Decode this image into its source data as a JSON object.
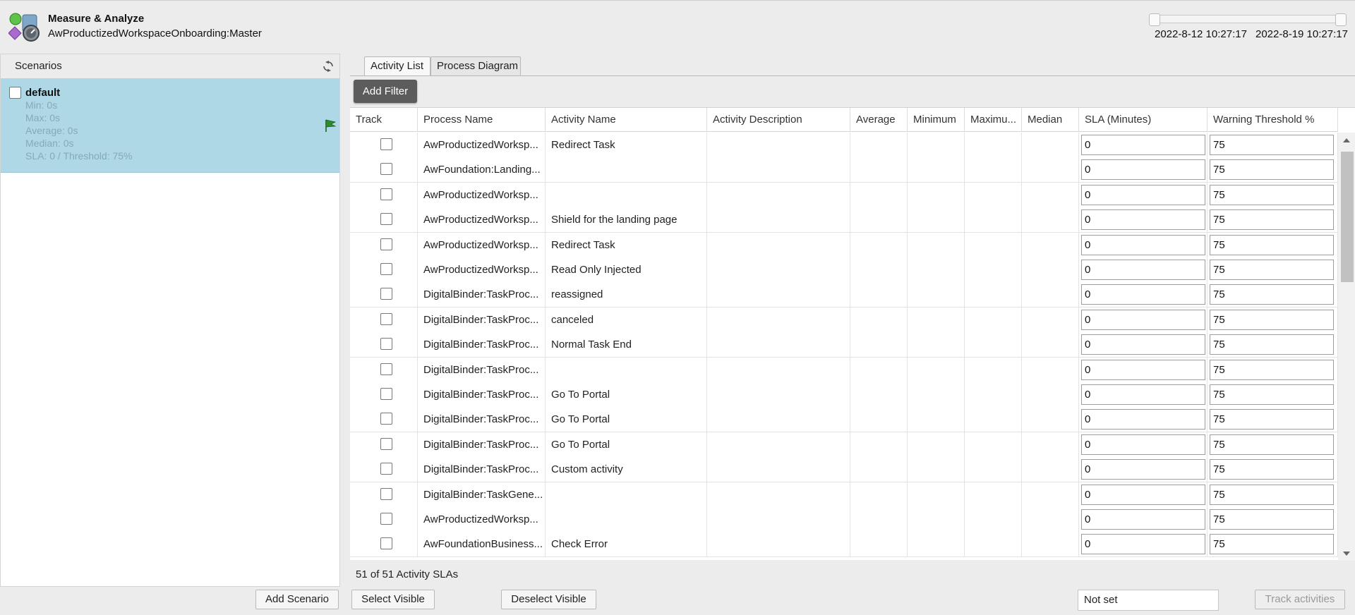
{
  "header": {
    "title": "Measure & Analyze",
    "subtitle": "AwProductizedWorkspaceOnboarding:Master",
    "date_start": "2022-8-12 10:27:17",
    "date_end": "2022-8-19 10:27:17"
  },
  "scenarios": {
    "title": "Scenarios",
    "items": [
      {
        "name": "default",
        "stats": [
          "Min: 0s",
          "Max: 0s",
          "Average: 0s",
          "Median: 0s",
          "SLA: 0 / Threshold: 75%"
        ]
      }
    ],
    "add_button": "Add Scenario"
  },
  "tabs": [
    "Activity List",
    "Process Diagram"
  ],
  "toolbar": {
    "add_filter": "Add Filter"
  },
  "table": {
    "columns": [
      "Track",
      "Process Name",
      "Activity Name",
      "Activity Description",
      "Average",
      "Minimum",
      "Maximu...",
      "Median",
      "SLA (Minutes)",
      "Warning Threshold %"
    ],
    "rows": [
      {
        "process": "AwProductizedWorksp...",
        "activity": "Redirect Task",
        "sla": "0",
        "threshold": "75"
      },
      {
        "process": "AwFoundation:Landing...",
        "activity": "",
        "sla": "0",
        "threshold": "75"
      },
      {
        "process": "AwProductizedWorksp...",
        "activity": "",
        "sla": "0",
        "threshold": "75"
      },
      {
        "process": "AwProductizedWorksp...",
        "activity": "Shield for the landing page",
        "sla": "0",
        "threshold": "75"
      },
      {
        "process": "AwProductizedWorksp...",
        "activity": "Redirect Task",
        "sla": "0",
        "threshold": "75"
      },
      {
        "process": "AwProductizedWorksp...",
        "activity": "Read Only Injected",
        "sla": "0",
        "threshold": "75"
      },
      {
        "process": "DigitalBinder:TaskProc...",
        "activity": "reassigned",
        "sla": "0",
        "threshold": "75"
      },
      {
        "process": "DigitalBinder:TaskProc...",
        "activity": "canceled",
        "sla": "0",
        "threshold": "75"
      },
      {
        "process": "DigitalBinder:TaskProc...",
        "activity": "Normal Task End",
        "sla": "0",
        "threshold": "75"
      },
      {
        "process": "DigitalBinder:TaskProc...",
        "activity": "",
        "sla": "0",
        "threshold": "75"
      },
      {
        "process": "DigitalBinder:TaskProc...",
        "activity": "Go To Portal",
        "sla": "0",
        "threshold": "75"
      },
      {
        "process": "DigitalBinder:TaskProc...",
        "activity": "Go To Portal",
        "sla": "0",
        "threshold": "75"
      },
      {
        "process": "DigitalBinder:TaskProc...",
        "activity": "Go To Portal",
        "sla": "0",
        "threshold": "75"
      },
      {
        "process": "DigitalBinder:TaskProc...",
        "activity": "Custom activity",
        "sla": "0",
        "threshold": "75"
      },
      {
        "process": "DigitalBinder:TaskGene...",
        "activity": "",
        "sla": "0",
        "threshold": "75"
      },
      {
        "process": "AwProductizedWorksp...",
        "activity": "",
        "sla": "0",
        "threshold": "75"
      },
      {
        "process": "AwFoundationBusiness...",
        "activity": "Check Error",
        "sla": "0",
        "threshold": "75"
      }
    ]
  },
  "summary": "51 of 51 Activity SLAs",
  "footer": {
    "select_visible": "Select Visible",
    "deselect_visible": "Deselect Visible",
    "track_select_value": "Not set",
    "track_activities": "Track activities"
  },
  "icons": {
    "app": "measure-analyze-icon",
    "refresh": "refresh-icon",
    "flag": "flag-icon"
  },
  "colors": {
    "selected_scenario": "#aed8e6",
    "add_filter_bg": "#5c5c5c",
    "flag": "#2e8b2e"
  }
}
